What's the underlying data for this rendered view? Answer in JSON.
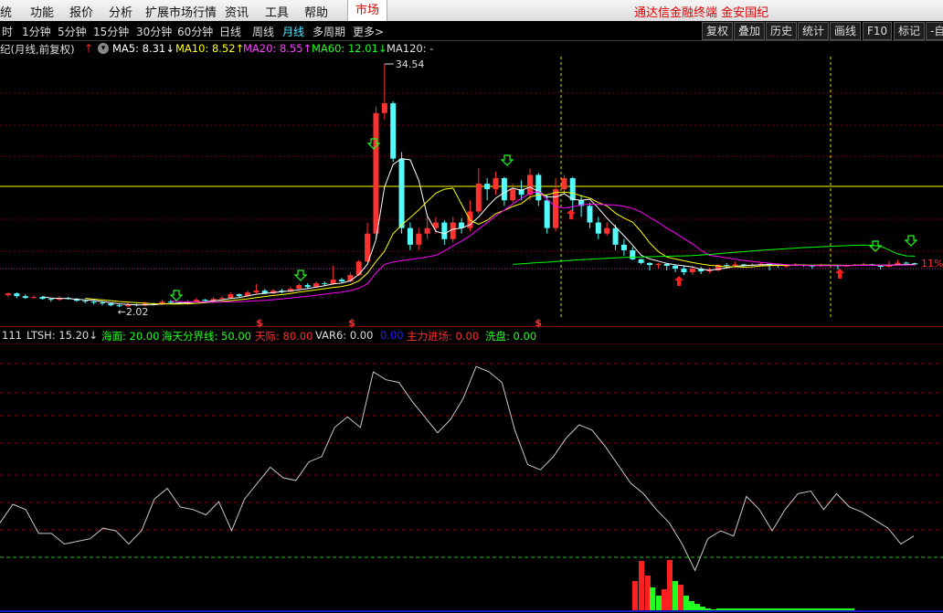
{
  "menu": {
    "items": [
      "统",
      "功能",
      "报价",
      "分析",
      "扩展市场行情",
      "资讯",
      "工具",
      "帮助"
    ],
    "market_tab": "市场",
    "brand": "通达信金融终端 金安国纪"
  },
  "periods": {
    "items": [
      "时",
      "1分钟",
      "5分钟",
      "15分钟",
      "30分钟",
      "60分钟",
      "日线",
      "周线",
      "月线",
      "多周期",
      "更多>"
    ],
    "active": "月线",
    "tools": [
      "复权",
      "叠加",
      "历史",
      "统计",
      "画线",
      "F10",
      "标记",
      "-自"
    ]
  },
  "ma_legend": {
    "title": "纪(月线,前复权)",
    "ma5": "MA5: 8.31↓",
    "ma10": "MA10: 8.52↑",
    "ma20": "MA20: 8.55↑",
    "ma60": "MA60: 12.01↓",
    "ma120": "MA120: -"
  },
  "main_chart": {
    "high_label": "34.54",
    "low_label": "2.02",
    "pct_label": "11%",
    "dollar_marker": "$",
    "colors": {
      "up": "#ff3232",
      "down": "#54fcfc",
      "ma5": "#ffffff",
      "ma10": "#ffff00",
      "ma20": "#ff00ff",
      "ma60": "#00ff00",
      "hline": "#ffff00"
    }
  },
  "ind_legend": {
    "name": "111",
    "ltsh": "LTSH: 15.20↓",
    "haimian": "海面: 20.00",
    "fenjie": "海天分界线: 50.00",
    "tianji": "天际: 80.00",
    "var6": "VAR6: 0.00",
    "blank": "0.00",
    "zhuli": "主力进场: 0.00",
    "xipan": "洗盘: 0.00"
  },
  "chart_data": {
    "type": "candlestick",
    "candles": [
      [
        3.3,
        3.5,
        3.6,
        3.1
      ],
      [
        3.5,
        3.2,
        3.6,
        3.0
      ],
      [
        3.2,
        3.0,
        3.4,
        2.9
      ],
      [
        3.0,
        3.1,
        3.3,
        2.9
      ],
      [
        3.1,
        2.9,
        3.2,
        2.8
      ],
      [
        2.9,
        2.8,
        3.0,
        2.6
      ],
      [
        2.8,
        3.0,
        3.2,
        2.7
      ],
      [
        3.0,
        2.9,
        3.1,
        2.8
      ],
      [
        2.9,
        2.7,
        3.0,
        2.6
      ],
      [
        2.7,
        2.6,
        2.8,
        2.4
      ],
      [
        2.6,
        2.5,
        2.7,
        2.3
      ],
      [
        2.5,
        2.4,
        2.6,
        2.2
      ],
      [
        2.4,
        2.2,
        2.5,
        2.1
      ],
      [
        2.2,
        2.1,
        2.3,
        2.0
      ],
      [
        2.1,
        2.3,
        2.5,
        2.0
      ],
      [
        2.3,
        2.2,
        2.4,
        2.1
      ],
      [
        2.2,
        2.4,
        2.6,
        2.1
      ],
      [
        2.4,
        2.3,
        2.5,
        2.2
      ],
      [
        2.3,
        2.6,
        2.8,
        2.2
      ],
      [
        2.6,
        2.5,
        2.8,
        2.4
      ],
      [
        2.5,
        2.4,
        2.6,
        2.3
      ],
      [
        2.4,
        2.6,
        2.8,
        2.3
      ],
      [
        2.6,
        2.8,
        3.0,
        2.5
      ],
      [
        2.8,
        2.7,
        2.9,
        2.6
      ],
      [
        2.7,
        2.9,
        3.1,
        2.6
      ],
      [
        2.9,
        3.0,
        3.2,
        2.8
      ],
      [
        3.0,
        3.4,
        3.6,
        2.9
      ],
      [
        3.4,
        3.2,
        3.5,
        3.1
      ],
      [
        3.2,
        3.6,
        3.8,
        3.1
      ],
      [
        3.6,
        3.8,
        4.5,
        3.5
      ],
      [
        3.8,
        3.5,
        4.0,
        3.4
      ],
      [
        3.5,
        3.8,
        4.0,
        3.4
      ],
      [
        3.8,
        3.7,
        4.0,
        3.5
      ],
      [
        3.7,
        4.0,
        4.2,
        3.6
      ],
      [
        4.0,
        4.4,
        4.6,
        3.9
      ],
      [
        4.4,
        4.2,
        4.6,
        4.0
      ],
      [
        4.2,
        4.6,
        4.8,
        4.1
      ],
      [
        4.6,
        4.5,
        4.8,
        4.3
      ],
      [
        4.5,
        5.0,
        6.5,
        4.4
      ],
      [
        5.0,
        4.8,
        5.2,
        4.6
      ],
      [
        4.8,
        5.5,
        5.8,
        4.7
      ],
      [
        5.5,
        8.0,
        8.5,
        5.4
      ],
      [
        8.0,
        12.0,
        13.0,
        7.8
      ],
      [
        12.0,
        27.0,
        28.0,
        11.5
      ],
      [
        27.0,
        28.5,
        34.54,
        26.0
      ],
      [
        28.5,
        20.0,
        28.8,
        19.5
      ],
      [
        20.0,
        12.5,
        21.0,
        12.0
      ],
      [
        12.5,
        11.0,
        13.0,
        10.5
      ],
      [
        11.0,
        12.0,
        12.5,
        10.5
      ],
      [
        12.0,
        12.5,
        13.5,
        11.5
      ],
      [
        12.5,
        13.0,
        13.5,
        12.0
      ],
      [
        13.0,
        11.5,
        13.2,
        11.0
      ],
      [
        11.5,
        13.0,
        13.5,
        11.2
      ],
      [
        13.0,
        12.5,
        13.4,
        12.0
      ],
      [
        12.5,
        14.0,
        15.0,
        12.2
      ],
      [
        14.0,
        16.5,
        18.5,
        13.8
      ],
      [
        16.5,
        16.0,
        17.0,
        15.0
      ],
      [
        16.0,
        17.0,
        18.0,
        15.5
      ],
      [
        17.0,
        15.0,
        17.2,
        14.5
      ],
      [
        15.0,
        16.0,
        16.5,
        14.8
      ],
      [
        16.0,
        15.5,
        16.8,
        15.0
      ],
      [
        15.5,
        17.5,
        18.5,
        15.0
      ],
      [
        17.5,
        15.0,
        17.8,
        14.5
      ],
      [
        15.0,
        12.5,
        15.5,
        12.0
      ],
      [
        12.5,
        16.0,
        17.0,
        12.2
      ],
      [
        16.0,
        17.0,
        17.5,
        15.5
      ],
      [
        17.0,
        15.0,
        17.2,
        14.0
      ],
      [
        15.0,
        14.5,
        15.5,
        13.5
      ],
      [
        14.5,
        13.0,
        14.8,
        12.5
      ],
      [
        13.0,
        12.0,
        13.5,
        11.5
      ],
      [
        12.0,
        12.5,
        13.0,
        11.8
      ],
      [
        12.5,
        11.0,
        12.8,
        10.5
      ],
      [
        11.0,
        10.5,
        11.5,
        10.0
      ],
      [
        10.5,
        8.8,
        10.8,
        8.5
      ],
      [
        8.8,
        7.5,
        9.0,
        7.0
      ],
      [
        7.5,
        6.8,
        7.8,
        6.0
      ],
      [
        6.8,
        7.2,
        7.5,
        6.2
      ],
      [
        7.2,
        6.5,
        7.4,
        6.0
      ],
      [
        6.5,
        6.2,
        6.8,
        5.8
      ],
      [
        6.2,
        5.8,
        6.5,
        5.5
      ],
      [
        5.8,
        6.2,
        6.5,
        5.5
      ],
      [
        6.2,
        5.9,
        6.4,
        5.6
      ],
      [
        5.9,
        6.0,
        6.3,
        5.7
      ],
      [
        6.0,
        6.8,
        7.2,
        5.9
      ],
      [
        6.8,
        6.5,
        7.5,
        6.3
      ],
      [
        6.5,
        7.0,
        8.0,
        6.4
      ],
      [
        7.0,
        6.6,
        7.2,
        6.3
      ],
      [
        6.6,
        6.9,
        7.4,
        6.5
      ],
      [
        6.9,
        7.2,
        7.8,
        6.7
      ],
      [
        7.2,
        6.8,
        7.4,
        6.0
      ],
      [
        6.8,
        6.5,
        7.0,
        6.3
      ],
      [
        6.5,
        6.6,
        6.9,
        6.3
      ],
      [
        6.6,
        6.9,
        7.5,
        6.5
      ],
      [
        6.9,
        6.6,
        7.0,
        6.4
      ],
      [
        6.6,
        6.5,
        6.8,
        6.2
      ],
      [
        6.5,
        6.8,
        7.2,
        6.4
      ],
      [
        6.8,
        6.7,
        7.0,
        6.5
      ],
      [
        6.7,
        6.5,
        6.9,
        6.1
      ],
      [
        6.5,
        6.6,
        7.0,
        6.4
      ],
      [
        6.6,
        6.9,
        7.2,
        6.5
      ],
      [
        6.9,
        7.0,
        7.6,
        6.8
      ],
      [
        7.0,
        6.6,
        7.2,
        6.5
      ],
      [
        6.6,
        6.4,
        6.8,
        6.1
      ],
      [
        6.4,
        6.8,
        8.2,
        6.3
      ],
      [
        6.8,
        7.6,
        8.6,
        6.6
      ],
      [
        7.6,
        7.4,
        8.0,
        7.2
      ],
      [
        7.4,
        7.0,
        7.6,
        6.8
      ]
    ],
    "ltsh": [
      33,
      40,
      38,
      29,
      29,
      25,
      26,
      27,
      31,
      30,
      25,
      30,
      42,
      46,
      39,
      38,
      36,
      41,
      30,
      42,
      48,
      54,
      50,
      49,
      56,
      58,
      69,
      73,
      69,
      90,
      87,
      86,
      79,
      73,
      67,
      72,
      80,
      92,
      90,
      86,
      68,
      55,
      53,
      58,
      65,
      70,
      68,
      62,
      55,
      48,
      44,
      38,
      33,
      25,
      15,
      27,
      30,
      28,
      43,
      38,
      30,
      38,
      44,
      45,
      38,
      44,
      39,
      37,
      34,
      31,
      25,
      28
    ]
  }
}
